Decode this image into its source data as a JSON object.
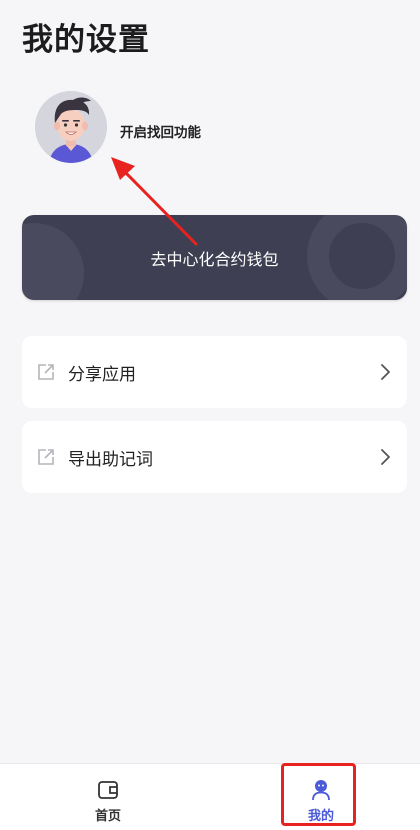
{
  "header": {
    "title": "我的设置"
  },
  "profile": {
    "avatar_icon": "user-avatar-icon",
    "recovery_label": "开启找回功能"
  },
  "wallet_card": {
    "label": "去中心化合约钱包",
    "background_color": "#3e3f53"
  },
  "menu": {
    "items": [
      {
        "label": "分享应用",
        "icon": "external-link-icon"
      },
      {
        "label": "导出助记词",
        "icon": "external-link-icon"
      }
    ]
  },
  "tabbar": {
    "tabs": [
      {
        "label": "首页",
        "icon": "wallet-icon",
        "active": false
      },
      {
        "label": "我的",
        "icon": "profile-icon",
        "active": true
      }
    ],
    "active_color": "#4a5ad8"
  },
  "annotations": {
    "color": "#e8231f"
  }
}
